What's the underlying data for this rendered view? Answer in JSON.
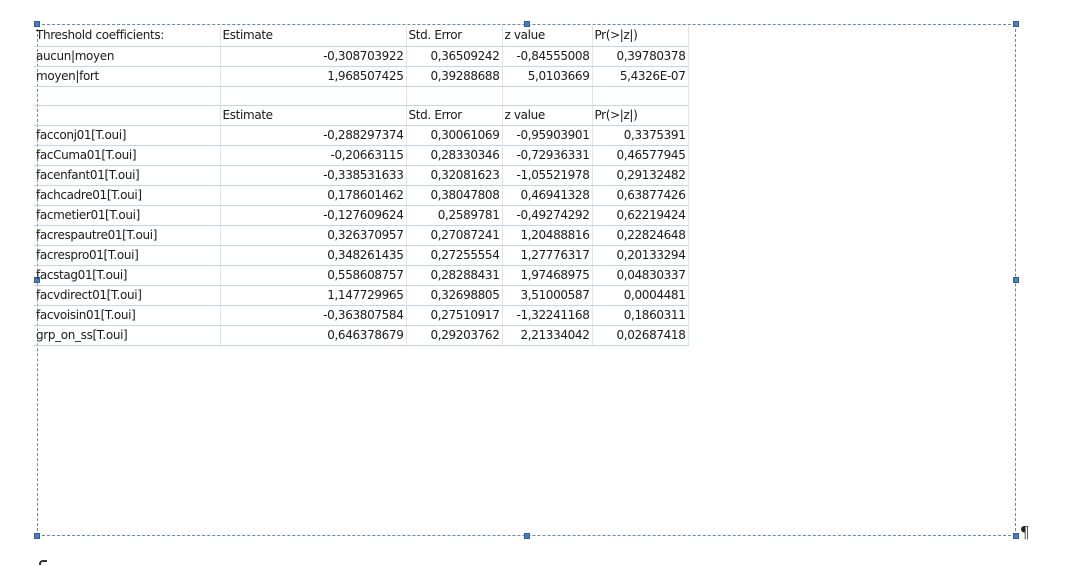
{
  "threshold_table": {
    "headers": [
      "Threshold coefficients:",
      "Estimate",
      "Std. Error",
      "z value",
      "Pr(>|z|)"
    ],
    "rows": [
      [
        "aucun|moyen",
        "-0,308703922",
        "0,36509242",
        "-0,84555008",
        "0,39780378"
      ],
      [
        "moyen|fort",
        "1,968507425",
        "0,39288688",
        "5,0103669",
        "5,4326E-07"
      ]
    ]
  },
  "coefficient_table": {
    "headers": [
      "",
      "Estimate",
      "Std. Error",
      "z value",
      "Pr(>|z|)"
    ],
    "rows": [
      [
        "facconj01[T.oui]",
        "-0,288297374",
        "0,30061069",
        "-0,95903901",
        "0,3375391"
      ],
      [
        "facCuma01[T.oui]",
        "-0,20663115",
        "0,28330346",
        "-0,72936331",
        "0,46577945"
      ],
      [
        "facenfant01[T.oui]",
        "-0,338531633",
        "0,32081623",
        "-1,05521978",
        "0,29132482"
      ],
      [
        "fachcadre01[T.oui]",
        "0,178601462",
        "0,38047808",
        "0,46941328",
        "0,63877426"
      ],
      [
        "facmetier01[T.oui]",
        "-0,127609624",
        "0,2589781",
        "-0,49274292",
        "0,62219424"
      ],
      [
        "facrespautre01[T.oui]",
        "0,326370957",
        "0,27087241",
        "1,20488816",
        "0,22824648"
      ],
      [
        "facrespro01[T.oui]",
        "0,348261435",
        "0,27255554",
        "1,27776317",
        "0,20133294"
      ],
      [
        "facstag01[T.oui]",
        "0,558608757",
        "0,28288431",
        "1,97468975",
        "0,04830337"
      ],
      [
        "facvdirect01[T.oui]",
        "1,147729965",
        "0,32698805",
        "3,51000587",
        "0,0004481"
      ],
      [
        "facvoisin01[T.oui]",
        "-0,363807584",
        "0,27510917",
        "-1,32241168",
        "0,1860311"
      ],
      [
        "grp_on_ss[T.oui]",
        "0,646378679",
        "0,29203762",
        "2,21334042",
        "0,02687418"
      ]
    ]
  },
  "paragraph_mark": "¶",
  "colors": {
    "frame_border": "#5b8cc8",
    "handle": "#4a7ebb",
    "grid_line": "#c9d3e6"
  }
}
